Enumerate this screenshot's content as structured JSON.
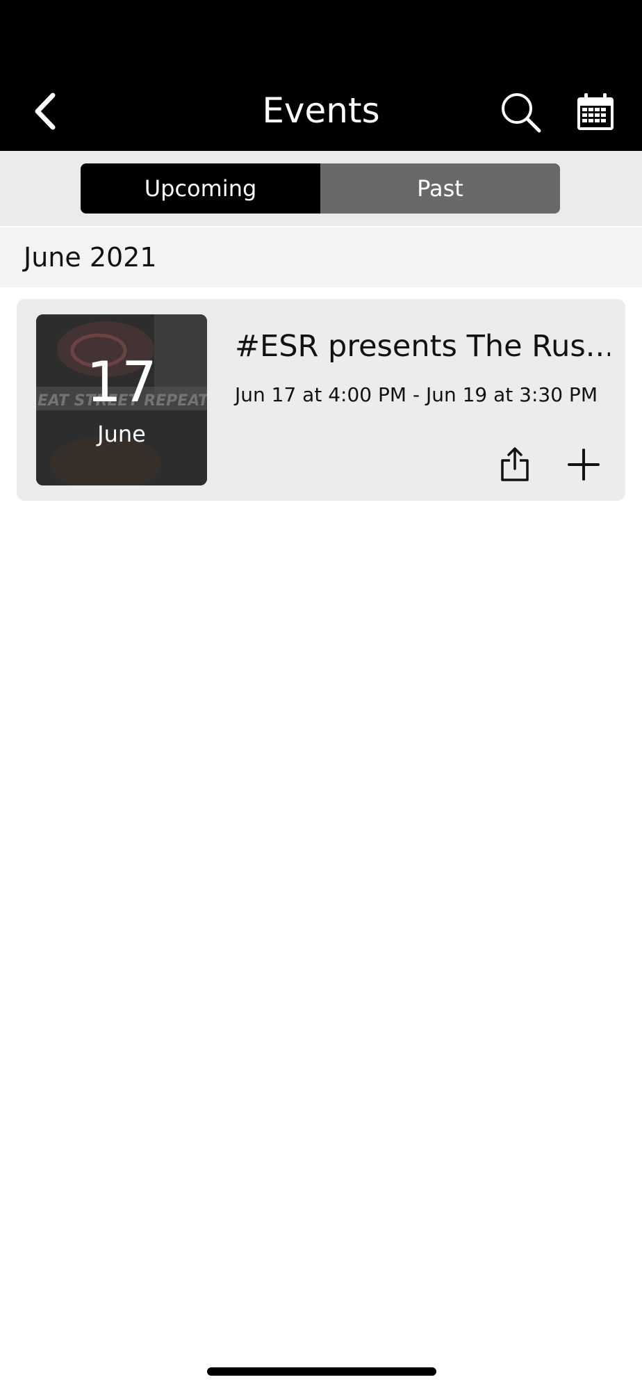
{
  "header": {
    "title": "Events",
    "back_icon": "chevron-left-icon",
    "search_icon": "search-icon",
    "calendar_icon": "calendar-icon"
  },
  "tabs": [
    {
      "label": "Upcoming",
      "selected": true
    },
    {
      "label": "Past",
      "selected": false
    }
  ],
  "month_label": "June 2021",
  "events": [
    {
      "day": "17",
      "month": "June",
      "title": "#ESR presents The Rus...",
      "dates": "Jun 17 at 4:00 PM - Jun 19 at 3:30 PM",
      "thumbnail_watermark": "EAT STREET REPEAT",
      "share_icon": "share-icon",
      "add_icon": "plus-icon"
    }
  ],
  "colors": {
    "header_bg": "#000000",
    "segment_selected": "#000000",
    "segment_unselected": "#696969",
    "card_bg": "#ececec"
  }
}
